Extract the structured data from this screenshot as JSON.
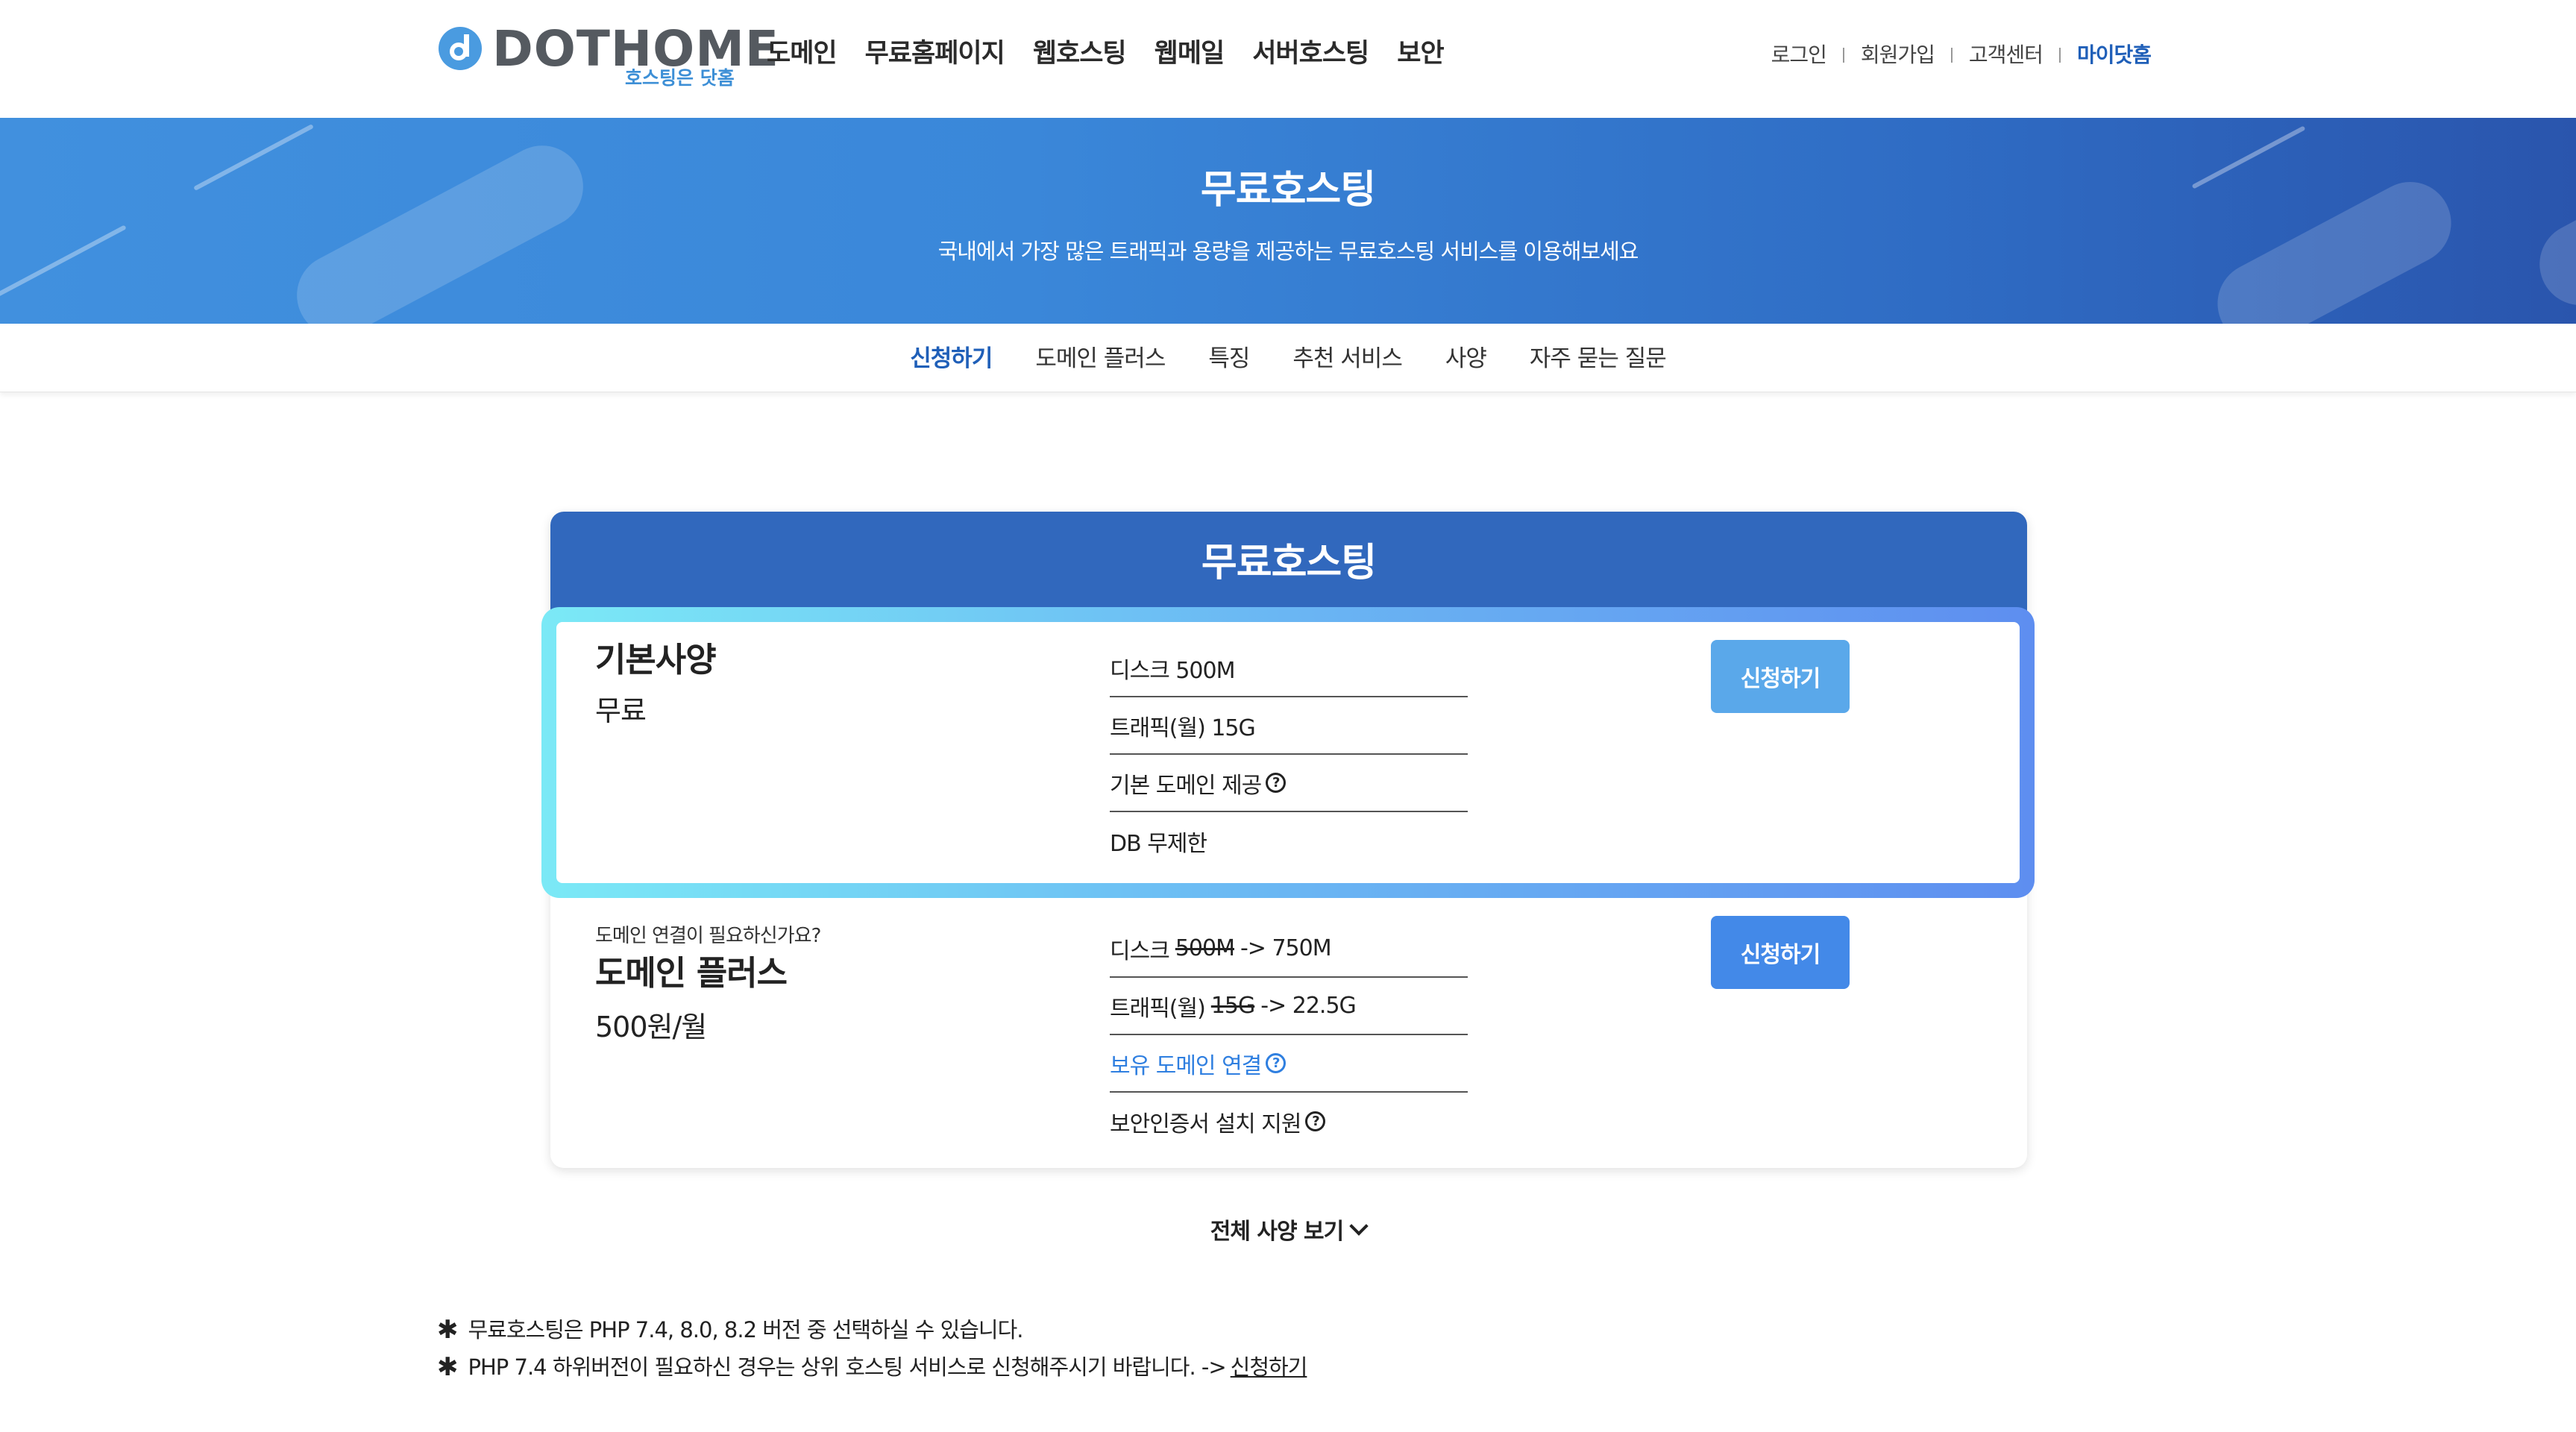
{
  "colors": {
    "accent": "#1f5fb8",
    "banner": "#3a87d9",
    "card_head": "#3168bd",
    "button": "#4389e8",
    "link": "#2f7fe0"
  },
  "header": {
    "logo_text": "DOTHOME",
    "logo_tagline": "호스팅은 닷홈",
    "nav": [
      "도메인",
      "무료홈페이지",
      "웹호스팅",
      "웹메일",
      "서버호스팅",
      "보안"
    ],
    "util": {
      "login": "로그인",
      "signup": "회원가입",
      "support": "고객센터",
      "mypage": "마이닷홈"
    }
  },
  "banner": {
    "title": "무료호스팅",
    "subtitle": "국내에서 가장 많은 트래픽과 용량을 제공하는 무료호스팅 서비스를 이용해보세요"
  },
  "subnav": [
    "신청하기",
    "도메인 플러스",
    "특징",
    "추천 서비스",
    "사양",
    "자주 묻는 질문"
  ],
  "card": {
    "title": "무료호스팅",
    "basic": {
      "name": "기본사양",
      "price": "무료",
      "specs": [
        "디스크 500M",
        "트래픽(월) 15G",
        "기본 도메인 제공",
        "DB 무제한"
      ],
      "button": "신청하기"
    },
    "plus": {
      "pre": "도메인 연결이 필요하신가요?",
      "name": "도메인 플러스",
      "price": "500원/월",
      "disk": {
        "label": "디스크",
        "old": "500M",
        "new": "-> 750M"
      },
      "traffic": {
        "label": "트래픽(월)",
        "old": "15G",
        "new": "-> 22.5G"
      },
      "own_domain": "보유 도메인 연결",
      "ssl": "보안인증서 설치 지원",
      "button": "신청하기"
    }
  },
  "more_label": "전체 사양 보기",
  "notes": {
    "star": "✱",
    "line1": "무료호스팅은 PHP 7.4, 8.0, 8.2 버전 중 선택하실 수 있습니다.",
    "line2": "PHP 7.4 하위버전이 필요하신 경우는 상위 호스팅 서비스로 신청해주시기 바랍니다. ->",
    "line2_link": "신청하기"
  },
  "icons": {
    "help": "question-circle-icon",
    "more": "chevron-down-icon"
  }
}
